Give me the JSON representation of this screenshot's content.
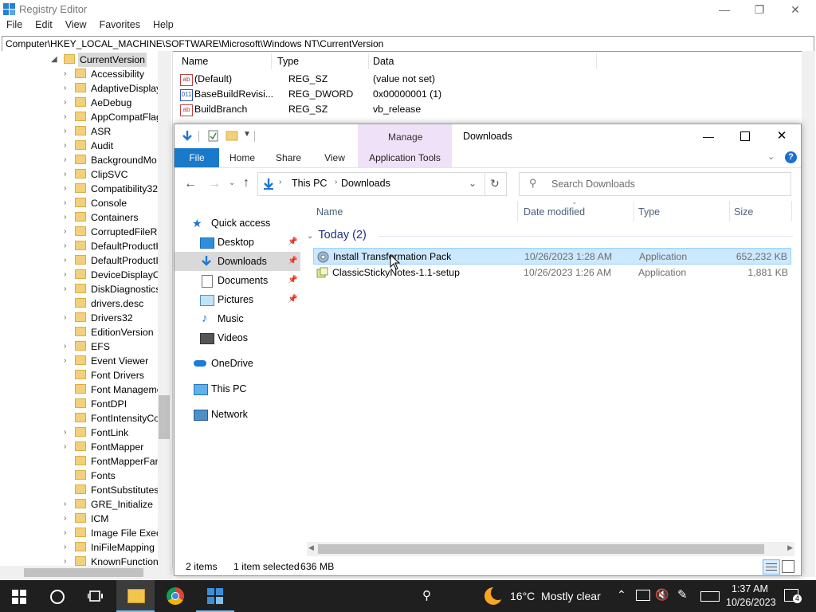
{
  "regedit": {
    "title": "Registry Editor",
    "menu": [
      "File",
      "Edit",
      "View",
      "Favorites",
      "Help"
    ],
    "address": "Computer\\HKEY_LOCAL_MACHINE\\SOFTWARE\\Microsoft\\Windows NT\\CurrentVersion",
    "tree_items": [
      "CurrentVersion",
      "Accessibility",
      "AdaptiveDisplay",
      "AeDebug",
      "AppCompatFlag",
      "ASR",
      "Audit",
      "BackgroundMo",
      "ClipSVC",
      "Compatibility32",
      "Console",
      "Containers",
      "CorruptedFileRe",
      "DefaultProductI",
      "DefaultProductI",
      "DeviceDisplayO",
      "DiskDiagnostics",
      "drivers.desc",
      "Drivers32",
      "EditionVersion",
      "EFS",
      "Event Viewer",
      "Font Drivers",
      "Font Manageme",
      "FontDPI",
      "FontIntensityCo",
      "FontLink",
      "FontMapper",
      "FontMapperFan",
      "Fonts",
      "FontSubstitutes",
      "GRE_Initialize",
      "ICM",
      "Image File Execu",
      "IniFileMapping",
      "KnownFunction"
    ],
    "columns": [
      "Name",
      "Type",
      "Data"
    ],
    "values": [
      {
        "name": "(Default)",
        "type": "REG_SZ",
        "data": "(value not set)",
        "icon": "ab"
      },
      {
        "name": "BaseBuildRevisi...",
        "type": "REG_DWORD",
        "data": "0x00000001 (1)",
        "icon": "011"
      },
      {
        "name": "BuildBranch",
        "type": "REG_SZ",
        "data": "vb_release",
        "icon": "ab"
      }
    ]
  },
  "explorer": {
    "title": "Downloads",
    "manage_tab": "Manage",
    "ribbon_tabs": [
      "File",
      "Home",
      "Share",
      "View",
      "Application Tools"
    ],
    "breadcrumb": [
      "This PC",
      "Downloads"
    ],
    "search_placeholder": "Search Downloads",
    "nav": {
      "quick_access": "Quick access",
      "desktop": "Desktop",
      "downloads": "Downloads",
      "documents": "Documents",
      "pictures": "Pictures",
      "music": "Music",
      "videos": "Videos",
      "onedrive": "OneDrive",
      "this_pc": "This PC",
      "network": "Network"
    },
    "columns": {
      "name": "Name",
      "date": "Date modified",
      "type": "Type",
      "size": "Size"
    },
    "group_header": "Today (2)",
    "files": [
      {
        "name": "Install Transformation Pack",
        "date": "10/26/2023 1:28 AM",
        "type": "Application",
        "size": "652,232 KB",
        "selected": true
      },
      {
        "name": "ClassicStickyNotes-1.1-setup",
        "date": "10/26/2023 1:26 AM",
        "type": "Application",
        "size": "1,881 KB",
        "selected": false
      }
    ],
    "status": {
      "count": "2 items",
      "selected": "1 item selected",
      "size": "636 MB"
    }
  },
  "taskbar": {
    "weather": "16°C  Mostly clear",
    "time": "1:37 AM",
    "date": "10/26/2023",
    "notifications": "4"
  },
  "colors": {
    "accent": "#0078d7",
    "manage": "#efe1f7",
    "selection": "#cce8ff",
    "taskbar": "#1f1f1f"
  }
}
